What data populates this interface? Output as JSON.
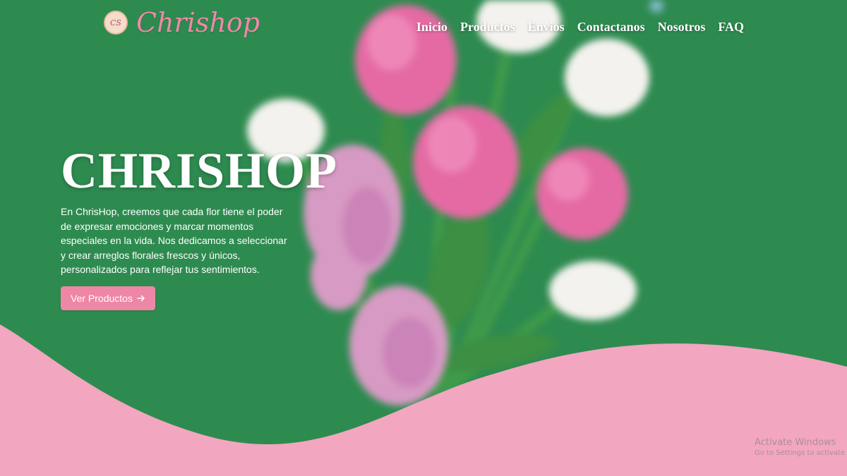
{
  "brand": {
    "name": "Chrishop",
    "badge_text": "CS"
  },
  "nav": {
    "items": [
      "Inicio",
      "Productos",
      "Envios",
      "Contactanos",
      "Nosotros",
      "FAQ"
    ]
  },
  "hero": {
    "title": "CHRISHOP",
    "description": "En ChrisHop, creemos que cada flor tiene el poder de expresar emociones y marcar momentos especiales en la vida. Nos dedicamos a seleccionar y crear arreglos florales frescos y únicos, personalizados para reflejar tus sentimientos.",
    "cta_label": "Ver Productos",
    "cta_icon": "arrow-right-icon"
  },
  "system": {
    "activate_title": "Activate Windows",
    "activate_sub": "Go to Settings to activate Windows."
  },
  "colors": {
    "background": "#2e8b50",
    "wave": "#f2a6bf",
    "accent": "#ee86a6",
    "text": "#ffffff"
  }
}
